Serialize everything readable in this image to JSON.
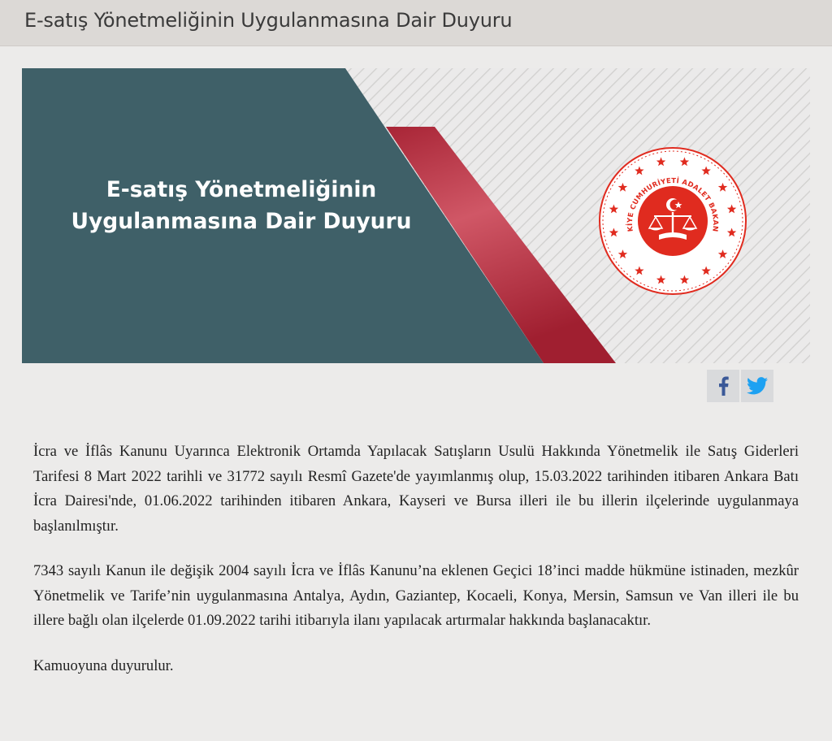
{
  "page": {
    "title": "E-satış Yönetmeliğinin Uygulanmasına Dair Duyuru"
  },
  "banner": {
    "heading_line1": "E-satış Yönetmeliğinin",
    "heading_line2": "Uygulanmasına Dair Duyuru",
    "seal_text": "TÜRKİYE CUMHURİYETİ ADALET BAKANLIĞI",
    "colors": {
      "panel": "#3f6068",
      "ribbon": "#b02a3a",
      "seal": "#e02b1f"
    },
    "icons": [
      "ministry-seal-icon"
    ]
  },
  "share": {
    "icons": [
      "facebook-icon",
      "twitter-icon"
    ],
    "colors": {
      "facebook": "#3b5998",
      "twitter": "#1da1f2"
    }
  },
  "content": {
    "paragraphs": [
      "İcra ve İflâs Kanunu Uyarınca Elektronik Ortamda Yapılacak Satışların Usulü Hakkında Yönetmelik ile Satış Giderleri Tarifesi 8 Mart 2022 tarihli ve 31772 sayılı Resmî Gazete'de yayımlanmış olup, 15.03.2022 tarihinden itibaren Ankara Batı İcra Dairesi'nde, 01.06.2022 tarihinden itibaren Ankara, Kayseri ve Bursa illeri ile bu illerin ilçelerinde uygulanmaya başlanılmıştır.",
      "7343 sayılı Kanun ile değişik 2004 sayılı İcra ve İflâs Kanunu’na eklenen Geçici 18’inci madde hükmüne istinaden, mezkûr Yönetmelik ve Tarife’nin uygulanmasına Antalya, Aydın, Gaziantep, Kocaeli, Konya, Mersin, Samsun ve Van illeri ile bu illere bağlı olan ilçelerde 01.09.2022 tarihi itibarıyla ilanı yapılacak artırmalar hakkında başlanacaktır.",
      "Kamuoyuna duyurulur."
    ]
  }
}
